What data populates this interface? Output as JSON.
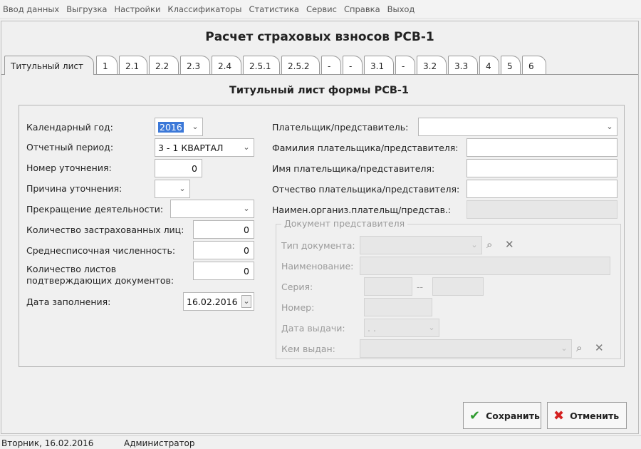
{
  "menu": [
    "Ввод данных",
    "Выгрузка",
    "Настройки",
    "Классификаторы",
    "Статистика",
    "Сервис",
    "Справка",
    "Выход"
  ],
  "window_title": "Расчет страховых взносов РСВ-1",
  "tabs": [
    "Титульный лист",
    "1",
    "2.1",
    "2.2",
    "2.3",
    "2.4",
    "2.5.1",
    "2.5.2",
    "-",
    "-",
    "3.1",
    "-",
    "3.2",
    "3.3",
    "4",
    "5",
    "6"
  ],
  "panel_title": "Титульный лист формы РСВ-1",
  "left": {
    "year_label": "Календарный год:",
    "year_value": "2016",
    "period_label": "Отчетный период:",
    "period_value": "3 - 1 КВАРТАЛ",
    "correction_label": "Номер уточнения:",
    "correction_value": "0",
    "reason_label": "Причина уточнения:",
    "reason_value": "",
    "termination_label": "Прекращение деятельности:",
    "termination_value": "",
    "insured_label": "Количество застрахованных лиц:",
    "insured_value": "0",
    "avg_label": "Среднесписочная численность:",
    "avg_value": "0",
    "sheets_label_1": "Количество листов",
    "sheets_label_2": "подтверждающих документов:",
    "sheets_value": "0",
    "date_label": "Дата заполнения:",
    "date_value": "16.02.2016"
  },
  "right": {
    "payer_label": "Плательщик/представитель:",
    "payer_value": "",
    "surname_label": "Фамилия плательщика/представителя:",
    "surname_value": "",
    "name_label": "Имя плательщика/представителя:",
    "name_value": "",
    "patronymic_label": "Отчество плательщика/представителя:",
    "patronymic_value": "",
    "org_label": "Наимен.организ.плательщ/представ.:",
    "org_value": ""
  },
  "doc_group": {
    "title": "Документ представителя",
    "type_label": "Тип документа:",
    "name_label": "Наименование:",
    "series_label": "Серия:",
    "series_sep": "--",
    "number_label": "Номер:",
    "issue_date_label": "Дата выдачи:",
    "issue_date_value": ". .",
    "issued_by_label": "Кем выдан:"
  },
  "buttons": {
    "save": "Сохранить",
    "cancel": "Отменить"
  },
  "status": {
    "date": "Вторник, 16.02.2016",
    "user": "Администратор"
  },
  "colors": {
    "save_icon": "#2e9a2e",
    "cancel_icon": "#d42020",
    "selection": "#3b78d8"
  },
  "icons": {
    "dropdown": "chevron-down-icon",
    "search": "magnifier-icon",
    "clear": "close-icon",
    "save": "check-icon",
    "cancel": "x-icon"
  }
}
